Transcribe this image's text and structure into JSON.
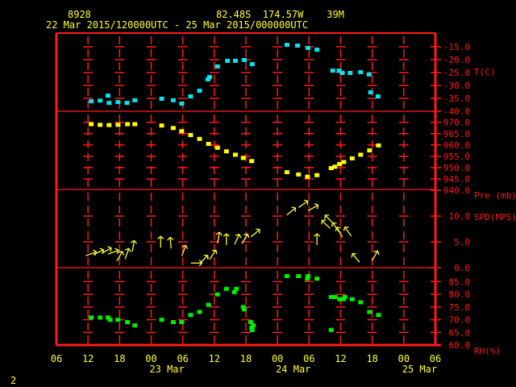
{
  "header": {
    "station_id": "8928",
    "location": "82.48S  174.57W    39M",
    "period": "22 Mar 2015/120000UTC - 25 Mar 2015/000000UTC"
  },
  "footer": {
    "page_number": "2"
  },
  "colors": {
    "frame": "#ff1a1a",
    "text": "#ffff33",
    "temperature": "#00e5ee",
    "pressure": "#ffff00",
    "wind": "#ffff33",
    "rh": "#00ee00"
  },
  "x_axis": {
    "unit": "hours since 22 Mar 06UTC",
    "range": [
      0,
      72
    ],
    "hour_labels": [
      "06",
      "12",
      "18",
      "00",
      "06",
      "12",
      "18",
      "00",
      "06",
      "12",
      "18",
      "00",
      "06"
    ],
    "date_labels": [
      {
        "text": "23 Mar",
        "at": 21
      },
      {
        "text": "24 Mar",
        "at": 45
      },
      {
        "text": "25 Mar",
        "at": 69
      }
    ]
  },
  "chart_data": [
    {
      "type": "scatter",
      "label": "T(C)",
      "ylim": [
        -40,
        -15
      ],
      "tick_labels": [
        "-15.0",
        "-20.0",
        "-25.0",
        "-30.0",
        "-35.0",
        "-40.0"
      ],
      "ticks": [
        -15,
        -20,
        -25,
        -30,
        -35,
        -40
      ],
      "x": [
        6.6,
        8.3,
        9.8,
        10.0,
        11.7,
        13.4,
        14.9,
        20.0,
        22.2,
        23.8,
        25.5,
        27.2,
        28.8,
        29.1,
        30.6,
        32.5,
        34.0,
        35.7,
        37.2,
        43.8,
        45.8,
        47.8,
        49.5,
        52.5,
        53.7,
        54.3,
        55.8,
        57.8,
        59.4,
        59.7,
        61.1
      ],
      "y": [
        -36.3,
        -36.0,
        -34.1,
        -36.9,
        -36.6,
        -36.9,
        -35.9,
        -35.3,
        -35.9,
        -37.2,
        -34.4,
        -32.2,
        -27.8,
        -26.9,
        -22.8,
        -20.6,
        -20.6,
        -20.3,
        -21.9,
        -14.4,
        -14.7,
        -15.6,
        -16.3,
        -24.4,
        -24.4,
        -25.3,
        -25.3,
        -25.0,
        -25.9,
        -32.8,
        -34.4
      ]
    },
    {
      "type": "scatter",
      "label": "Pre (mb)",
      "ylim": [
        940,
        970
      ],
      "tick_labels": [
        "970.0",
        "965.0",
        "960.0",
        "955.0",
        "950.0",
        "945.0",
        "940.0"
      ],
      "ticks": [
        970,
        965,
        960,
        955,
        950,
        945,
        940
      ],
      "x": [
        6.6,
        8.3,
        10.0,
        11.7,
        13.5,
        14.9,
        20.0,
        22.2,
        23.8,
        25.5,
        27.2,
        28.9,
        30.6,
        32.3,
        34.0,
        35.5,
        37.1,
        43.8,
        46.0,
        47.7,
        49.5,
        52.2,
        52.9,
        53.8,
        54.6,
        56.2,
        57.8,
        59.5,
        61.2
      ],
      "y": [
        969.0,
        968.7,
        968.6,
        968.7,
        969.0,
        969.0,
        968.4,
        967.3,
        965.9,
        964.2,
        962.5,
        960.3,
        958.6,
        957.0,
        955.5,
        954.1,
        952.7,
        947.8,
        946.8,
        945.8,
        946.5,
        949.6,
        950.2,
        951.4,
        952.3,
        953.9,
        955.5,
        957.4,
        959.6
      ]
    },
    {
      "type": "vector",
      "label": "SPD(MPS)",
      "ylim": [
        0,
        13
      ],
      "tick_labels": [
        "10.0",
        "5.0",
        "0.0"
      ],
      "ticks": [
        10,
        5,
        0
      ],
      "x": [
        6.6,
        8.0,
        9.5,
        10.8,
        12.0,
        13.4,
        14.6,
        19.8,
        21.7,
        24.2,
        26.6,
        28.0,
        29.7,
        30.8,
        32.3,
        34.3,
        35.8,
        37.8,
        44.6,
        46.9,
        48.8,
        49.5,
        51.8,
        51.2,
        53.1,
        53.8,
        55.4,
        56.9,
        60.5
      ],
      "speed": [
        2.7,
        3.0,
        3.3,
        3.0,
        2.2,
        2.7,
        4.2,
        5.0,
        4.8,
        3.3,
        0.9,
        1.6,
        2.5,
        5.8,
        5.5,
        5.5,
        5.6,
        6.7,
        10.9,
        12.3,
        11.6,
        5.5,
        9.4,
        8.4,
        7.8,
        6.9,
        7.0,
        1.9,
        2.3
      ],
      "arrow_angle_deg": [
        20,
        25,
        30,
        20,
        60,
        70,
        80,
        90,
        95,
        70,
        0,
        45,
        55,
        80,
        90,
        65,
        60,
        40,
        40,
        35,
        30,
        90,
        135,
        135,
        125,
        120,
        125,
        130,
        60
      ]
    },
    {
      "type": "scatter",
      "label": "RH(%)",
      "ylim": [
        60,
        88
      ],
      "tick_labels": [
        "85.0",
        "80.0",
        "75.0",
        "70.0",
        "65.0",
        "60.0"
      ],
      "ticks": [
        85,
        80,
        75,
        70,
        65,
        60
      ],
      "x": [
        6.6,
        8.3,
        9.8,
        10.2,
        11.7,
        13.5,
        14.9,
        20.0,
        22.2,
        23.8,
        25.5,
        27.2,
        28.9,
        30.6,
        32.3,
        33.8,
        34.2,
        35.5,
        35.7,
        36.9,
        37.4,
        37.1,
        37.2,
        43.8,
        46.0,
        47.8,
        47.7,
        49.5,
        52.2,
        52.2,
        52.9,
        53.8,
        54.5,
        54.8,
        56.2,
        57.8,
        59.5,
        61.2
      ],
      "y": [
        70.7,
        70.7,
        70.7,
        69.8,
        69.8,
        68.9,
        67.6,
        69.8,
        68.9,
        68.9,
        71.7,
        72.9,
        75.7,
        79.8,
        82.0,
        80.7,
        82.0,
        74.8,
        73.9,
        68.9,
        67.6,
        66.7,
        65.8,
        87.0,
        87.0,
        87.0,
        86.0,
        86.0,
        65.8,
        78.8,
        78.8,
        77.9,
        77.9,
        78.8,
        77.9,
        76.7,
        72.9,
        71.7
      ]
    }
  ]
}
